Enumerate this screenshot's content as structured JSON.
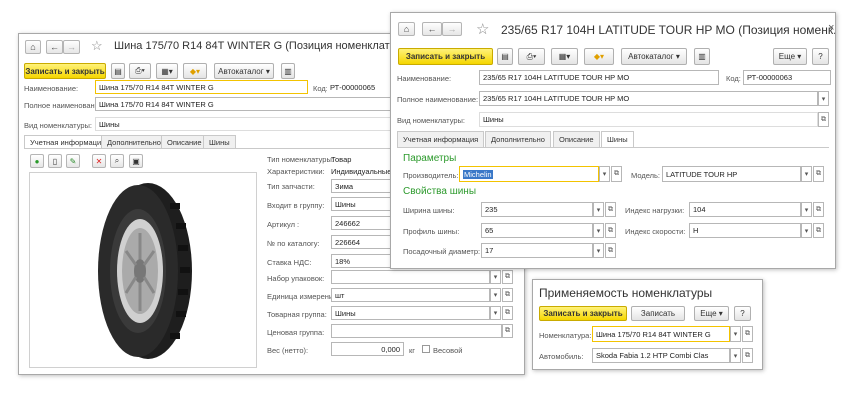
{
  "nav": {
    "home": "⌂",
    "back": "←",
    "forward": "→",
    "star": "☆"
  },
  "winA": {
    "title": "Шина 175/70 R14 84T WINTER G (Позиция номенклатуры)",
    "save_close": "Записать и закрыть",
    "autocatalog": "Автокаталог ▾",
    "name_label": "Наименование:",
    "name_value": "Шина 175/70 R14 84T WINTER G",
    "code_label": "Код:",
    "code_value": "РТ-00000065",
    "fullname_label": "Полное наименование:",
    "fullname_value": "Шина 175/70 R14 84T WINTER G",
    "kind_label": "Вид номенклатуры:",
    "kind_value": "Шины",
    "tabs": [
      "Учетная информация",
      "Дополнительно",
      "Описание",
      "Шины"
    ],
    "props": [
      {
        "label": "Тип номенклатуры:",
        "value": "Товар"
      },
      {
        "label": "Характеристики:",
        "value": "Индивидуальные д"
      },
      {
        "label": "Тип запчасти:",
        "value": "Зима"
      },
      {
        "label": "Входит в группу:",
        "value": "Шины"
      },
      {
        "label": "Артикул :",
        "value": "246662"
      },
      {
        "label": "№ по каталогу:",
        "value": "226664"
      },
      {
        "label": "Ставка НДС:",
        "value": "18%"
      },
      {
        "label": "Набор упаковок:",
        "value": ""
      },
      {
        "label": "Единица измерения:",
        "value": "шт"
      },
      {
        "label": "Товарная группа:",
        "value": "Шины"
      },
      {
        "label": "Ценовая группа:",
        "value": ""
      }
    ],
    "weight_label": "Вес (нетто):",
    "weight_value": "0,000",
    "weight_unit": "кг",
    "weight_check": "Весовой"
  },
  "winB": {
    "title": "235/65 R17 104H  LATITUDE TOUR HP MO (Позиция номенк...",
    "close": "×",
    "save_close": "Записать и закрыть",
    "autocatalog": "Автокаталог ▾",
    "more": "Еще ▾",
    "help": "?",
    "name_label": "Наименование:",
    "name_value": "235/65 R17 104H  LATITUDE TOUR HP MO",
    "code_label": "Код:",
    "code_value": "РТ-00000063",
    "fullname_label": "Полное наименование:",
    "fullname_value": "235/65 R17 104H  LATITUDE TOUR HP MO",
    "kind_label": "Вид номенклатуры:",
    "kind_value": "Шины",
    "tabs": [
      "Учетная информация",
      "Дополнительно",
      "Описание",
      "Шины"
    ],
    "params_title": "Параметры",
    "maker_label": "Производитель:",
    "maker_value": "Michelin",
    "model_label": "Модель:",
    "model_value": "LATITUDE TOUR HP",
    "tire_props_title": "Свойства шины",
    "width_label": "Ширина шины:",
    "width_value": "235",
    "load_label": "Индекс нагрузки:",
    "load_value": "104",
    "profile_label": "Профиль шины:",
    "profile_value": "65",
    "speed_label": "Индекс скорости:",
    "speed_value": "H",
    "diameter_label": "Посадочный диаметр:",
    "diameter_value": "17"
  },
  "winC": {
    "title": "Применяемость номенклатуры",
    "save_close": "Записать и закрыть",
    "save": "Записать",
    "more": "Еще ▾",
    "help": "?",
    "item_label": "Номенклатура:",
    "item_value": "Шина 175/70 R14 84T WINTER G",
    "car_label": "Автомобиль:",
    "car_value": "Skoda Fabia 1.2 HTP Combi Clas"
  },
  "colors": {
    "accent_yellow": "#f5d600",
    "section_green": "#2c9a2c",
    "selection_blue": "#3a78c8"
  },
  "icons": [
    "home-icon",
    "back-icon",
    "forward-icon",
    "star-icon",
    "save-icon",
    "print-icon",
    "report-icon",
    "create-based-icon",
    "list-icon",
    "close-icon"
  ]
}
